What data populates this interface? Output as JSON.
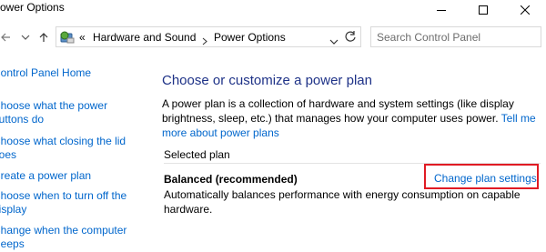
{
  "window": {
    "title": "Power Options"
  },
  "navigation": {
    "breadcrumb_prefix": "«",
    "breadcrumb": [
      "Hardware and Sound",
      "Power Options"
    ],
    "search_placeholder": "Search Control Panel"
  },
  "sidebar": {
    "home": "Control Panel Home",
    "links": [
      {
        "line1": "Choose what the power",
        "line2": "buttons do"
      },
      {
        "line1": "Choose what closing the lid",
        "line2": "does"
      },
      {
        "line1": "Create a power plan",
        "line2": ""
      },
      {
        "line1": "Choose when to turn off the",
        "line2": "display"
      },
      {
        "line1": "Change when the computer",
        "line2": "sleeps"
      }
    ]
  },
  "main": {
    "heading": "Choose or customize a power plan",
    "description_line1": "A power plan is a collection of hardware and system settings (like display",
    "description_line2": "brightness, sleep, etc.) that manages how your computer uses power.",
    "tell_more_link": "Tell me more about power plans",
    "selected_plan_label": "Selected plan",
    "plan_name": "Balanced (recommended)",
    "plan_description": "Automatically balances performance with energy consumption on capable hardware.",
    "change_plan_link": "Change plan settings"
  },
  "highlight": {
    "color": "#e01b24"
  }
}
